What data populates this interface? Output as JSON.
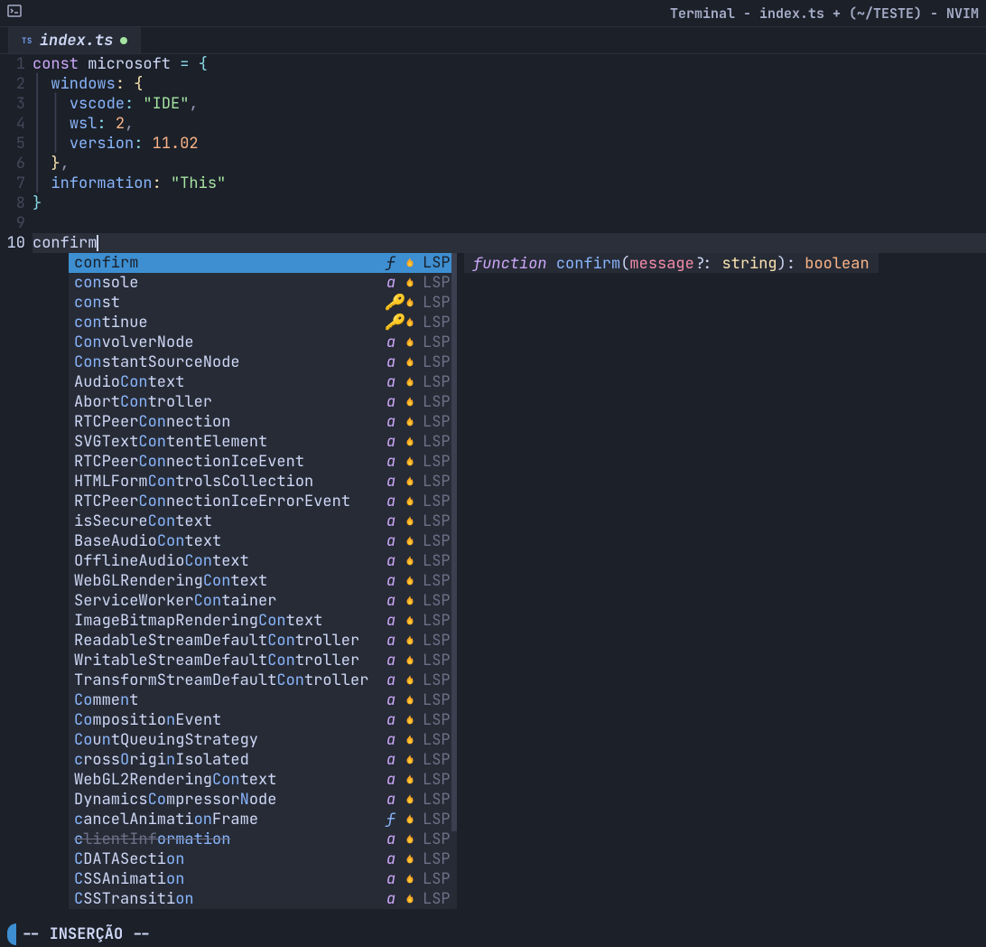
{
  "window": {
    "title": "Terminal - index.ts + (~/TESTE) - NVIM"
  },
  "tab": {
    "badge": "TS",
    "filename": "index.ts",
    "modified": true
  },
  "editor": {
    "current_line": 10,
    "lines": [
      {
        "n": 1,
        "tokens": [
          [
            "kw",
            "const"
          ],
          [
            "var",
            " microsoft "
          ],
          [
            "op",
            "="
          ],
          [
            "var",
            " "
          ],
          [
            "punc",
            "{"
          ]
        ]
      },
      {
        "n": 2,
        "tokens": [
          [
            "ind",
            "│ "
          ],
          [
            "prop",
            "windows"
          ],
          [
            "punc2",
            ":"
          ],
          [
            "var",
            " "
          ],
          [
            "punc2",
            "{"
          ]
        ]
      },
      {
        "n": 3,
        "tokens": [
          [
            "ind",
            "│ │ "
          ],
          [
            "prop",
            "vscode"
          ],
          [
            "punc",
            ":"
          ],
          [
            "var",
            " "
          ],
          [
            "str",
            "\"IDE\""
          ],
          [
            "muted",
            ","
          ]
        ]
      },
      {
        "n": 4,
        "tokens": [
          [
            "ind",
            "│ │ "
          ],
          [
            "prop",
            "wsl"
          ],
          [
            "punc",
            ":"
          ],
          [
            "var",
            " "
          ],
          [
            "num",
            "2"
          ],
          [
            "muted",
            ","
          ]
        ]
      },
      {
        "n": 5,
        "tokens": [
          [
            "ind",
            "│ │ "
          ],
          [
            "prop",
            "version"
          ],
          [
            "punc",
            ":"
          ],
          [
            "var",
            " "
          ],
          [
            "num",
            "11.02"
          ]
        ]
      },
      {
        "n": 6,
        "tokens": [
          [
            "ind",
            "│ "
          ],
          [
            "punc2",
            "}"
          ],
          [
            "muted",
            ","
          ]
        ]
      },
      {
        "n": 7,
        "tokens": [
          [
            "ind",
            "│ "
          ],
          [
            "prop",
            "information"
          ],
          [
            "punc2",
            ":"
          ],
          [
            "var",
            " "
          ],
          [
            "str",
            "\"This\""
          ]
        ]
      },
      {
        "n": 8,
        "tokens": [
          [
            "punc",
            "}"
          ]
        ]
      },
      {
        "n": 9,
        "tokens": []
      },
      {
        "n": 10,
        "tokens": [
          [
            "var",
            "confirm"
          ]
        ],
        "cursor": true
      }
    ]
  },
  "completion": {
    "selected_index": 0,
    "items": [
      {
        "segments": [
          [
            "",
            "confirm"
          ]
        ],
        "kind": "ƒ",
        "src": "LSP"
      },
      {
        "segments": [
          [
            "hl",
            "con"
          ],
          [
            "",
            "sole"
          ]
        ],
        "kind": "α",
        "src": "LSP"
      },
      {
        "segments": [
          [
            "hl",
            "con"
          ],
          [
            "",
            "st"
          ]
        ],
        "kind": "🔑",
        "src": "LSP"
      },
      {
        "segments": [
          [
            "hl",
            "con"
          ],
          [
            "",
            "tinue"
          ]
        ],
        "kind": "🔑",
        "src": "LSP"
      },
      {
        "segments": [
          [
            "hl",
            "Con"
          ],
          [
            "",
            "volverNode"
          ]
        ],
        "kind": "α",
        "src": "LSP"
      },
      {
        "segments": [
          [
            "hl",
            "Con"
          ],
          [
            "",
            "stantSourceNode"
          ]
        ],
        "kind": "α",
        "src": "LSP"
      },
      {
        "segments": [
          [
            "",
            "Audio"
          ],
          [
            "hl",
            "Con"
          ],
          [
            "",
            "text"
          ]
        ],
        "kind": "α",
        "src": "LSP"
      },
      {
        "segments": [
          [
            "",
            "Abort"
          ],
          [
            "hl",
            "Con"
          ],
          [
            "",
            "troller"
          ]
        ],
        "kind": "α",
        "src": "LSP"
      },
      {
        "segments": [
          [
            "",
            "RTCPeer"
          ],
          [
            "hl",
            "Con"
          ],
          [
            "",
            "nection"
          ]
        ],
        "kind": "α",
        "src": "LSP"
      },
      {
        "segments": [
          [
            "",
            "SVGText"
          ],
          [
            "hl",
            "Con"
          ],
          [
            "",
            "tentElement"
          ]
        ],
        "kind": "α",
        "src": "LSP"
      },
      {
        "segments": [
          [
            "",
            "RTCPeer"
          ],
          [
            "hl",
            "Con"
          ],
          [
            "",
            "nectionIceEvent"
          ]
        ],
        "kind": "α",
        "src": "LSP"
      },
      {
        "segments": [
          [
            "",
            "HTMLForm"
          ],
          [
            "hl",
            "Con"
          ],
          [
            "",
            "trolsCollection"
          ]
        ],
        "kind": "α",
        "src": "LSP"
      },
      {
        "segments": [
          [
            "",
            "RTCPeer"
          ],
          [
            "hl",
            "Con"
          ],
          [
            "",
            "nectionIceErrorEvent"
          ]
        ],
        "kind": "α",
        "src": "LSP"
      },
      {
        "segments": [
          [
            "",
            "isSecure"
          ],
          [
            "hl",
            "Con"
          ],
          [
            "",
            "text"
          ]
        ],
        "kind": "α",
        "src": "LSP"
      },
      {
        "segments": [
          [
            "",
            "BaseAudio"
          ],
          [
            "hl",
            "Con"
          ],
          [
            "",
            "text"
          ]
        ],
        "kind": "α",
        "src": "LSP"
      },
      {
        "segments": [
          [
            "",
            "OfflineAudio"
          ],
          [
            "hl",
            "Con"
          ],
          [
            "",
            "text"
          ]
        ],
        "kind": "α",
        "src": "LSP"
      },
      {
        "segments": [
          [
            "",
            "WebGLRendering"
          ],
          [
            "hl",
            "Con"
          ],
          [
            "",
            "text"
          ]
        ],
        "kind": "α",
        "src": "LSP"
      },
      {
        "segments": [
          [
            "",
            "ServiceWorker"
          ],
          [
            "hl",
            "Con"
          ],
          [
            "",
            "tainer"
          ]
        ],
        "kind": "α",
        "src": "LSP"
      },
      {
        "segments": [
          [
            "",
            "ImageBitmapRendering"
          ],
          [
            "hl",
            "Con"
          ],
          [
            "",
            "text"
          ]
        ],
        "kind": "α",
        "src": "LSP"
      },
      {
        "segments": [
          [
            "",
            "ReadableStreamDefault"
          ],
          [
            "hl",
            "Con"
          ],
          [
            "",
            "troller"
          ]
        ],
        "kind": "α",
        "src": "LSP"
      },
      {
        "segments": [
          [
            "",
            "WritableStreamDefault"
          ],
          [
            "hl",
            "Con"
          ],
          [
            "",
            "troller"
          ]
        ],
        "kind": "α",
        "src": "LSP"
      },
      {
        "segments": [
          [
            "",
            "TransformStreamDefault"
          ],
          [
            "hl",
            "Con"
          ],
          [
            "",
            "troller"
          ]
        ],
        "kind": "α",
        "src": "LSP"
      },
      {
        "segments": [
          [
            "hl",
            "Co"
          ],
          [
            "",
            "mme"
          ],
          [
            "hl",
            "n"
          ],
          [
            "",
            "t"
          ]
        ],
        "kind": "α",
        "src": "LSP"
      },
      {
        "segments": [
          [
            "hl",
            "Co"
          ],
          [
            "",
            "mpositio"
          ],
          [
            "hl",
            "n"
          ],
          [
            "",
            "Event"
          ]
        ],
        "kind": "α",
        "src": "LSP"
      },
      {
        "segments": [
          [
            "hl",
            "Co"
          ],
          [
            "",
            "u"
          ],
          [
            "hl",
            "n"
          ],
          [
            "",
            "tQueuingStrategy"
          ]
        ],
        "kind": "α",
        "src": "LSP"
      },
      {
        "segments": [
          [
            "hl",
            "c"
          ],
          [
            "",
            "ross"
          ],
          [
            "hl",
            "O"
          ],
          [
            "",
            "rigi"
          ],
          [
            "hl",
            "n"
          ],
          [
            "",
            "Isolated"
          ]
        ],
        "kind": "α",
        "src": "LSP"
      },
      {
        "segments": [
          [
            "",
            "WebGL2Rendering"
          ],
          [
            "hl",
            "Con"
          ],
          [
            "",
            "text"
          ]
        ],
        "kind": "α",
        "src": "LSP"
      },
      {
        "segments": [
          [
            "",
            "Dynamics"
          ],
          [
            "hl",
            "Co"
          ],
          [
            "",
            "mpressor"
          ],
          [
            "hl",
            "N"
          ],
          [
            "",
            "ode"
          ]
        ],
        "kind": "α",
        "src": "LSP"
      },
      {
        "segments": [
          [
            "hl",
            "c"
          ],
          [
            "",
            "ancelAnimati"
          ],
          [
            "hl",
            "on"
          ],
          [
            "",
            "Frame"
          ]
        ],
        "kind": "ƒ",
        "src": "LSP"
      },
      {
        "segments": [
          [
            "hl",
            "c"
          ],
          [
            "",
            "lientInf"
          ],
          [
            "hl",
            "ormation"
          ]
        ],
        "kind": "α",
        "src": "LSP",
        "deprecated": true
      },
      {
        "segments": [
          [
            "hl",
            "C"
          ],
          [
            "",
            "DATASecti"
          ],
          [
            "hl",
            "on"
          ]
        ],
        "kind": "α",
        "src": "LSP"
      },
      {
        "segments": [
          [
            "hl",
            "C"
          ],
          [
            "",
            "SSAnimati"
          ],
          [
            "hl",
            "on"
          ]
        ],
        "kind": "α",
        "src": "LSP"
      },
      {
        "segments": [
          [
            "hl",
            "C"
          ],
          [
            "",
            "SSTransiti"
          ],
          [
            "hl",
            "on"
          ]
        ],
        "kind": "α",
        "src": "LSP"
      }
    ]
  },
  "doc": {
    "tokens": [
      [
        "kw",
        "function"
      ],
      [
        "",
        " "
      ],
      [
        "fn",
        "confirm"
      ],
      [
        "",
        "("
      ],
      [
        "param",
        "message?"
      ],
      [
        "",
        ": "
      ],
      [
        "type",
        "string"
      ],
      [
        "",
        ")"
      ],
      [
        "",
        ": "
      ],
      [
        "ret",
        "boolean"
      ]
    ]
  },
  "status": {
    "mode": "-- INSERÇÃO --"
  }
}
